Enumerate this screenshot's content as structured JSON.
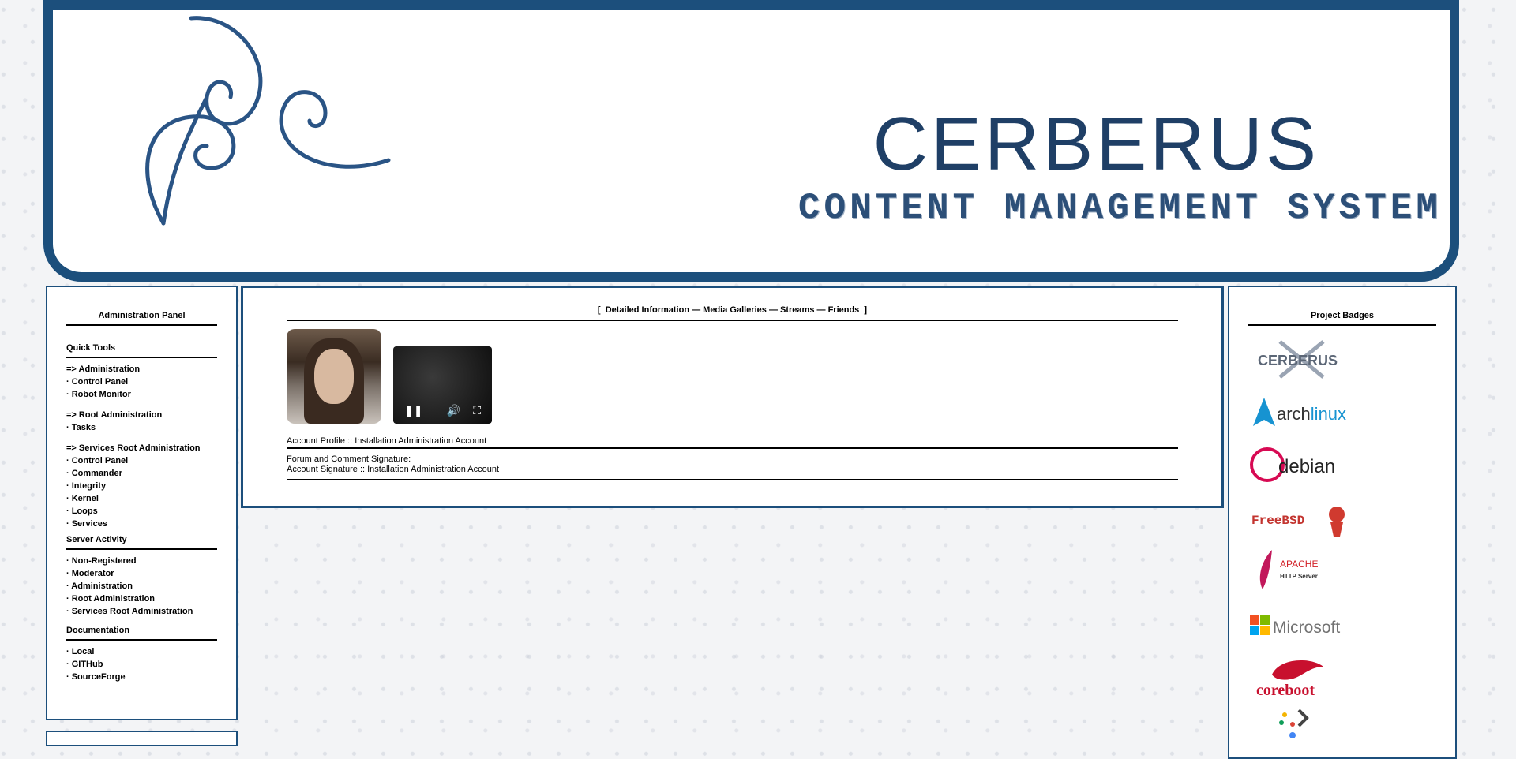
{
  "header": {
    "title": "CERBERUS",
    "subtitle": "CONTENT MANAGEMENT SYSTEM",
    "brand_color": "#1c4f7c"
  },
  "left_panel": {
    "title": "Administration Panel",
    "quick_tools": {
      "title": "Quick Tools",
      "groups": [
        [
          "=> Administration",
          "· Control Panel",
          "· Robot Monitor"
        ],
        [
          "=> Root Administration",
          "· Tasks"
        ],
        [
          "=> Services Root Administration",
          "· Control Panel",
          "· Commander",
          "· Integrity",
          "· Kernel",
          "· Loops",
          "· Services"
        ]
      ]
    },
    "server_activity": {
      "title": "Server Activity",
      "items": [
        "· Non-Registered",
        "· Moderator",
        "· Administration",
        "· Root Administration",
        "· Services Root Administration"
      ]
    },
    "documentation": {
      "title": "Documentation",
      "items": [
        "· Local",
        "· GITHub",
        "· SourceForge"
      ]
    }
  },
  "center_panel": {
    "tabs": {
      "open": "[",
      "items": [
        "Detailed Information",
        "Media Galleries",
        "Streams",
        "Friends"
      ],
      "separator": "—",
      "close": "]"
    },
    "video_controls": {
      "pause": "❚❚",
      "volume": "🔊",
      "fullscreen": "⛶"
    },
    "account_profile": "Account Profile :: Installation Administration Account",
    "signature_label": "Forum and Comment Signature:",
    "signature_value": "Account Signature :: Installation Administration Account"
  },
  "right_panel": {
    "title": "Project Badges",
    "badges": {
      "cerberus": "CERBERUS",
      "arch_word": "arch",
      "arch_suffix": "linux",
      "debian": "debian",
      "freebsd": "FreeBSD",
      "apache": "APACHE",
      "apache_sub": "HTTP Server",
      "microsoft": "Microsoft",
      "coreboot": "coreboot"
    }
  }
}
